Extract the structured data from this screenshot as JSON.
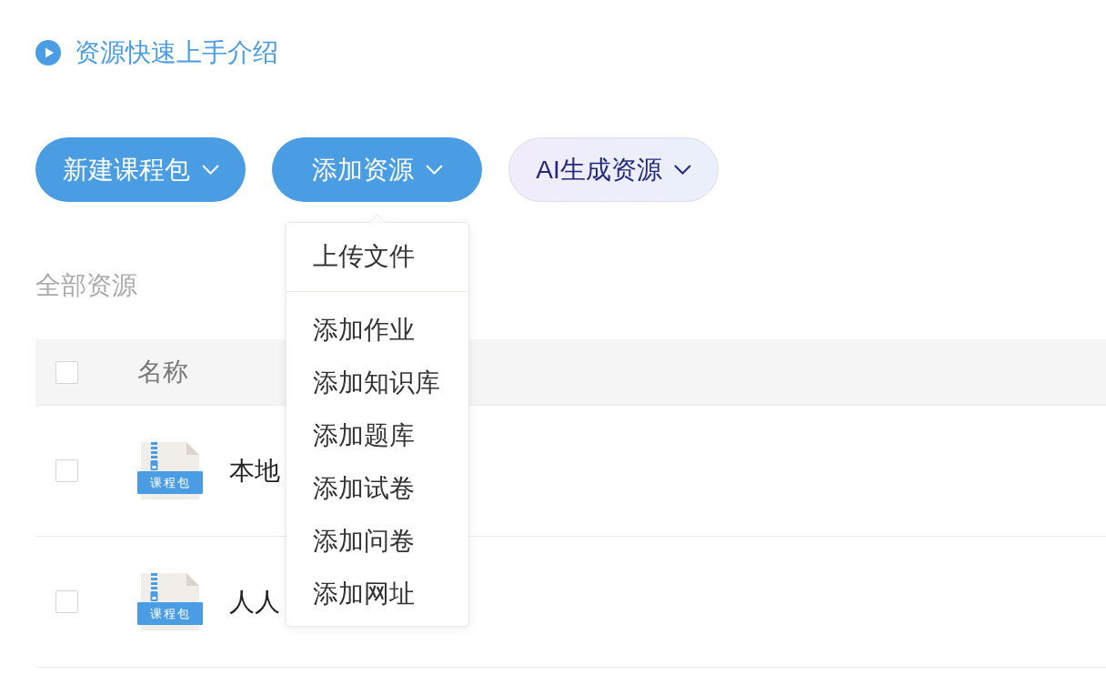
{
  "intro_link": {
    "label": "资源快速上手介绍"
  },
  "actions": [
    {
      "label": "新建课程包",
      "kind": "primary",
      "expanded": false
    },
    {
      "label": "添加资源",
      "kind": "primary",
      "expanded": true
    },
    {
      "label": "AI生成资源",
      "kind": "ai",
      "expanded": false
    }
  ],
  "dropdown": {
    "sections": [
      {
        "items": [
          "上传文件"
        ]
      },
      {
        "items": [
          "添加作业",
          "添加知识库",
          "添加题库",
          "添加试卷",
          "添加问卷",
          "添加网址"
        ]
      }
    ]
  },
  "section_title": "全部资源",
  "table": {
    "header": {
      "checked": false,
      "columns": [
        "名称"
      ]
    },
    "rows": [
      {
        "checked": false,
        "type_label": "课程包",
        "name": "本地"
      },
      {
        "checked": false,
        "type_label": "课程包",
        "name": "人人"
      }
    ]
  }
}
